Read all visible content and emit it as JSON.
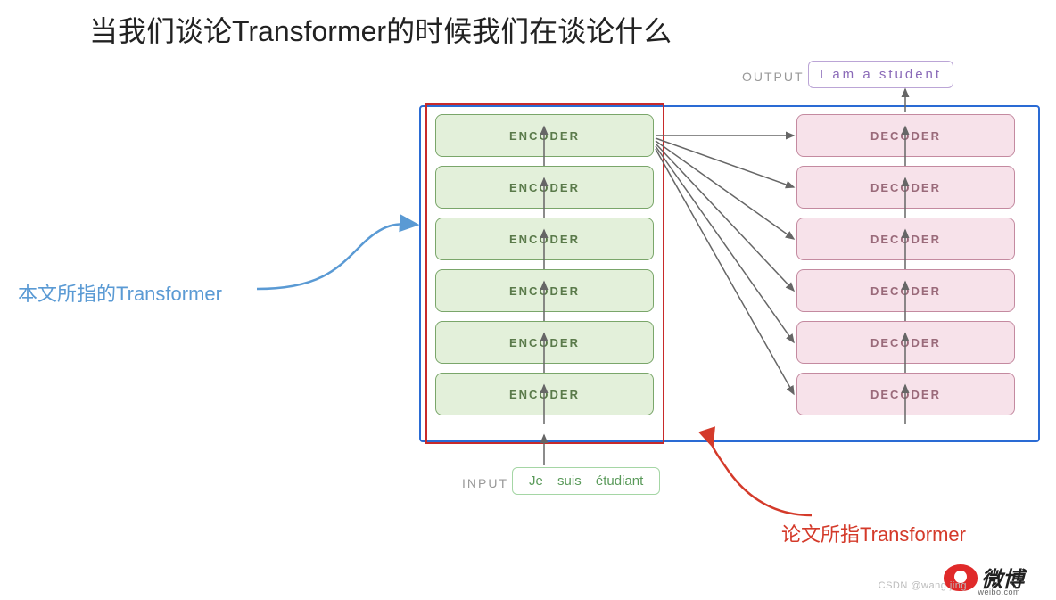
{
  "title": "当我们谈论Transformer的时候我们在谈论什么",
  "output": {
    "label": "OUTPUT",
    "tokens": "I   am   a   student"
  },
  "input": {
    "label": "INPUT",
    "tok1": "Je",
    "tok2": "suis",
    "tok3": "étudiant"
  },
  "encoders": [
    "ENCODER",
    "ENCODER",
    "ENCODER",
    "ENCODER",
    "ENCODER",
    "ENCODER"
  ],
  "decoders": [
    "DECODER",
    "DECODER",
    "DECODER",
    "DECODER",
    "DECODER",
    "DECODER"
  ],
  "annot": {
    "left": "本文所指的Transformer",
    "right": "论文所指Transformer"
  },
  "weibo": {
    "name": "微博",
    "domain": "weibo.com"
  },
  "watermark": "CSDN @wang jing"
}
